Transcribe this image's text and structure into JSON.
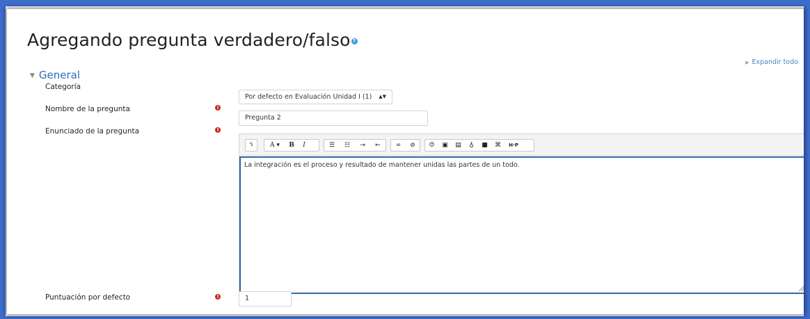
{
  "page": {
    "title": "Agregando pregunta verdadero/falso",
    "help_icon": "?",
    "expand_all": "Expandir todo"
  },
  "section": {
    "title": "General"
  },
  "fields": {
    "category_label": "Categoría",
    "category_value": "Por defecto en Evaluación Unidad I (1)",
    "name_label": "Nombre de la pregunta",
    "name_value": "Pregunta 2",
    "statement_label": "Enunciado de la pregunta",
    "statement_value": "La integración es el proceso y resultado de mantener unidas las partes de un todo.",
    "grade_label": "Puntuación por defecto",
    "grade_value": "1",
    "required_mark": "!"
  },
  "toolbar": {
    "collapse": "↴",
    "font": "A ▾",
    "bold": "B",
    "italic": "I",
    "h5p": "H·P"
  },
  "icons": {
    "collapse": "toolbar-toggle-icon",
    "font_style": "font-style-icon",
    "bold": "bold-icon",
    "italic": "italic-icon",
    "ul": "unordered-list-icon",
    "ol": "ordered-list-icon",
    "indent": "indent-icon",
    "outdent": "outdent-icon",
    "link": "link-icon",
    "unlink": "unlink-icon",
    "emoji": "emoji-icon",
    "image": "image-icon",
    "file": "file-icon",
    "audio": "microphone-icon",
    "video": "video-icon",
    "manage_files": "manage-files-icon",
    "h5p": "h5p-icon"
  },
  "colors": {
    "border_accent": "#3d6ccc",
    "link": "#2b6fb5",
    "required": "#c9241a",
    "editor_focus": "#2e6aa8"
  }
}
